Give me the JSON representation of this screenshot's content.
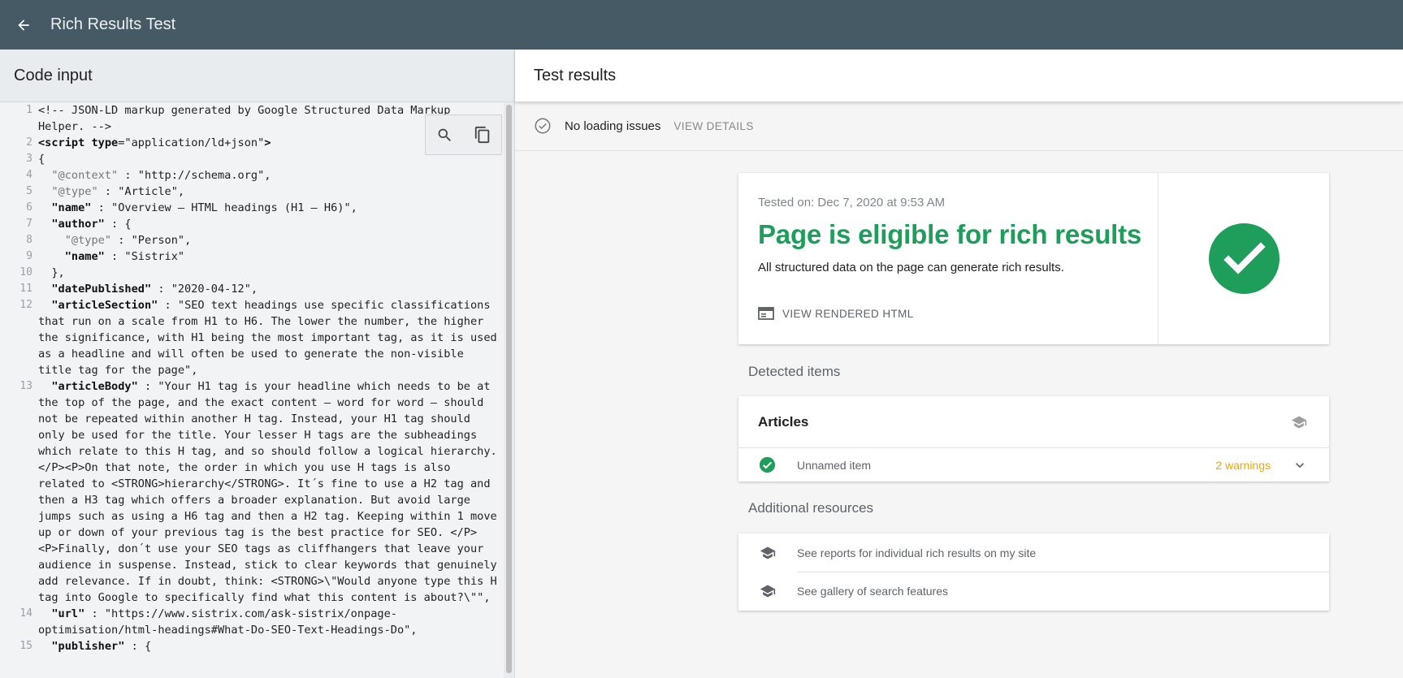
{
  "app": {
    "title": "Rich Results Test"
  },
  "left": {
    "title": "Code input",
    "lines": [
      {
        "n": "1",
        "segments": [
          {
            "t": "<!-- JSON-LD markup generated by Google Structured Data Markup\nHelper. -->",
            "c": ""
          }
        ]
      },
      {
        "n": "2",
        "segments": [
          {
            "t": "<script ",
            "c": "tg"
          },
          {
            "t": "type",
            "c": "tg"
          },
          {
            "t": "=\"application/ld+json\"",
            "c": ""
          },
          {
            "t": ">",
            "c": "tg"
          }
        ]
      },
      {
        "n": "3",
        "segments": [
          {
            "t": "{",
            "c": ""
          }
        ]
      },
      {
        "n": "4",
        "segments": [
          {
            "t": "  \"@context\"",
            "c": "dim"
          },
          {
            "t": " : \"http://schema.org\",",
            "c": ""
          }
        ]
      },
      {
        "n": "5",
        "segments": [
          {
            "t": "  \"@type\"",
            "c": "dim"
          },
          {
            "t": " : \"Article\",",
            "c": ""
          }
        ]
      },
      {
        "n": "6",
        "segments": [
          {
            "t": "  \"name\"",
            "c": "k"
          },
          {
            "t": " : \"Overview – HTML headings (H1 – H6)\",",
            "c": ""
          }
        ]
      },
      {
        "n": "7",
        "segments": [
          {
            "t": "  \"author\"",
            "c": "k"
          },
          {
            "t": " : {",
            "c": ""
          }
        ]
      },
      {
        "n": "8",
        "segments": [
          {
            "t": "    \"@type\"",
            "c": "dim"
          },
          {
            "t": " : \"Person\",",
            "c": ""
          }
        ]
      },
      {
        "n": "9",
        "segments": [
          {
            "t": "    \"name\"",
            "c": "k"
          },
          {
            "t": " : \"Sistrix\"",
            "c": ""
          }
        ]
      },
      {
        "n": "10",
        "segments": [
          {
            "t": "  },",
            "c": ""
          }
        ]
      },
      {
        "n": "11",
        "segments": [
          {
            "t": "  \"datePublished\"",
            "c": "k"
          },
          {
            "t": " : \"2020-04-12\",",
            "c": ""
          }
        ]
      },
      {
        "n": "12",
        "segments": [
          {
            "t": "  \"articleSection\"",
            "c": "k"
          },
          {
            "t": " : \"SEO text headings use specific classifications that run on a scale from H1 to H6. The lower the number, the higher the significance, with H1 being the most important tag, as it is used as a headline and will often be used to generate the non-visible title tag for the page\",",
            "c": ""
          }
        ]
      },
      {
        "n": "13",
        "segments": [
          {
            "t": "  \"articleBody\"",
            "c": "k"
          },
          {
            "t": " : \"Your H1 tag is your headline which needs to be at the top of the page, and the exact content – word for word – should not be repeated within another H tag. Instead, your H1 tag should only be used for the title. Your lesser H tags are the subheadings which relate to this H tag, and so should follow a logical hierarchy.</P><P>On that note, the order in which you use H tags is also related to <STRONG>hierarchy</STRONG>. It´s fine to use a H2 tag and then a H3 tag which offers a broader explanation. But avoid large jumps such as using a H6 tag and then a H2 tag. Keeping within 1 move up or down of your previous tag is the best practice for SEO. </P><P>Finally, don´t use your SEO tags as cliffhangers that leave your audience in suspense. Instead, stick to clear keywords that genuinely add relevance. If in doubt, think: <STRONG>\\\"Would anyone type this H tag into Google to specifically find what this content is about?\\\"\",",
            "c": ""
          }
        ]
      },
      {
        "n": "14",
        "segments": [
          {
            "t": "  \"url\"",
            "c": "k"
          },
          {
            "t": " : \"https://www.sistrix.com/ask-sistrix/onpage-optimisation/html-headings#What-Do-SEO-Text-Headings-Do\",",
            "c": ""
          }
        ]
      },
      {
        "n": "15",
        "segments": [
          {
            "t": "  \"publisher\"",
            "c": "k"
          },
          {
            "t": " : {",
            "c": ""
          }
        ]
      }
    ]
  },
  "right": {
    "title": "Test results",
    "loading": {
      "text": "No loading issues",
      "action": "VIEW DETAILS"
    },
    "summary": {
      "tested_on": "Tested on: Dec 7, 2020 at 9:53 AM",
      "headline": "Page is eligible for rich results",
      "subtext": "All structured data on the page can generate rich results.",
      "view_html": "VIEW RENDERED HTML",
      "status_color": "#1e9e5a"
    },
    "detected": {
      "title": "Detected items",
      "card_title": "Articles",
      "item_name": "Unnamed item",
      "item_warnings": "2 warnings"
    },
    "resources": {
      "title": "Additional resources",
      "items": [
        "See reports for individual rich results on my site",
        "See gallery of search features"
      ]
    }
  }
}
